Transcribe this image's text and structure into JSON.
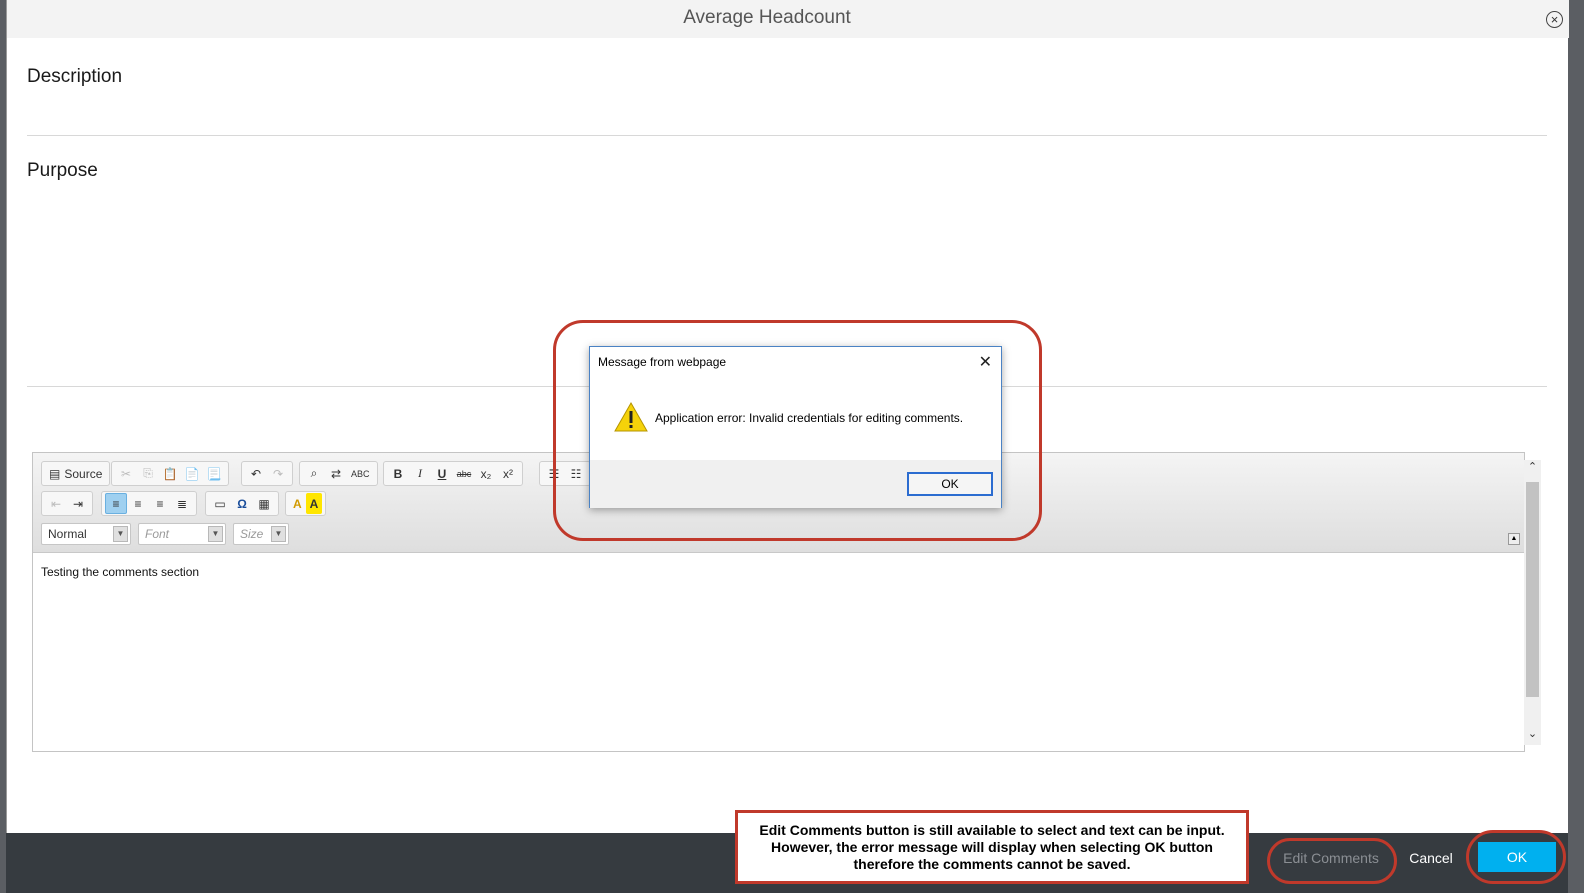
{
  "modal": {
    "title": "Average Headcount"
  },
  "sections": {
    "description": "Description",
    "purpose": "Purpose"
  },
  "editor": {
    "source_label": "Source",
    "format_combo": "Normal",
    "font_combo": "Font",
    "size_combo": "Size",
    "content": "Testing the comments section",
    "buttons": {
      "bold": "B",
      "italic": "I",
      "underline": "U",
      "strike": "abc",
      "subscript": "x₂",
      "superscript": "x²",
      "spellcheck": "ABC",
      "special_char": "Ω",
      "text_color": "A",
      "bg_color": "A"
    }
  },
  "footer": {
    "edit_comments": "Edit Comments",
    "cancel": "Cancel",
    "ok": "OK"
  },
  "annotation": {
    "line1": "Edit Comments button is still available to select and text can be input.",
    "line2": "However, the error message will display when selecting OK button",
    "line3": "therefore the comments cannot be saved."
  },
  "dialog": {
    "title": "Message from webpage",
    "message": "Application error: Invalid credentials for editing comments.",
    "ok": "OK"
  },
  "colors": {
    "accent": "#00b0ef",
    "annotation": "#c0392b",
    "footer": "#363b40"
  }
}
